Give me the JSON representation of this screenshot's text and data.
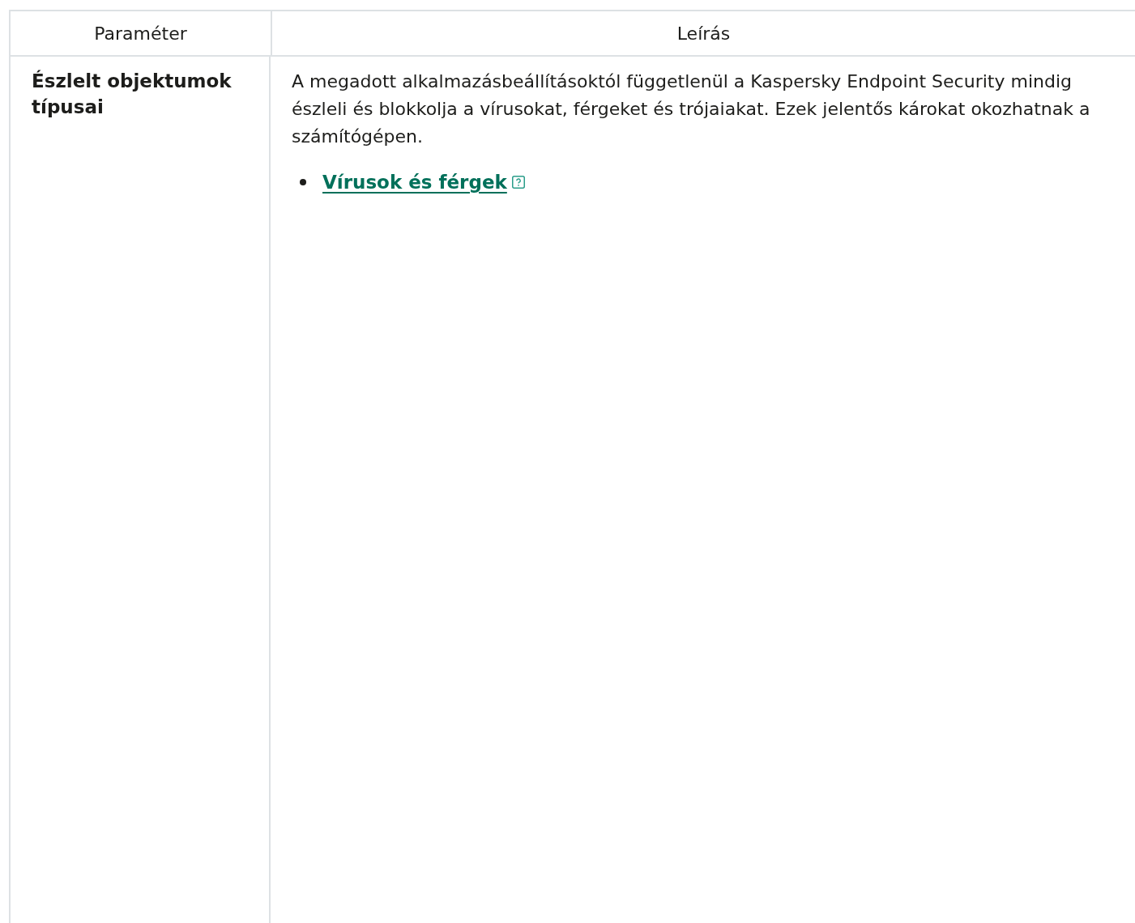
{
  "table": {
    "columns": [
      "Paraméter",
      "Leírás"
    ],
    "rows": [
      {
        "parameter": "Észlelt objektumok típusai",
        "description": "A megadott alkalmazásbeállításoktól függetlenül a Kaspersky Endpoint Security mindig észleli és blokkolja a vírusokat, férgeket és trójaiakat. Ezek jelentős károkat okozhatnak a számítógépen.",
        "links": [
          {
            "label": "Vírusok és férgek"
          }
        ]
      }
    ]
  }
}
